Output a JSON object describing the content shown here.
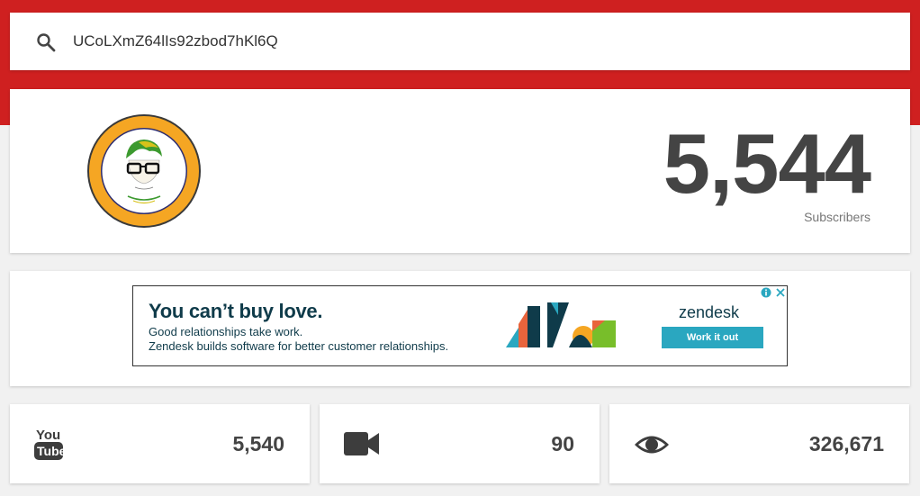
{
  "search": {
    "value": "UCoLXmZ64lIs92zbod7hKl6Q",
    "icon": "search-icon"
  },
  "channel": {
    "avatar_icon": "channel-avatar",
    "subscriber_count": "5,544",
    "subscriber_label": "Subscribers"
  },
  "ad": {
    "headline": "You can’t buy love.",
    "line1": "Good relationships take work.",
    "line2": "Zendesk builds software for better customer relationships.",
    "brand": "zendesk",
    "cta": "Work it out"
  },
  "stats": [
    {
      "icon": "youtube-logo-icon",
      "value": "5,540"
    },
    {
      "icon": "video-camera-icon",
      "value": "90"
    },
    {
      "icon": "eye-icon",
      "value": "326,671"
    }
  ],
  "colors": {
    "header_red": "#cf2020",
    "background": "#f1f1f1",
    "text": "#444444",
    "ad_cta": "#2aa7c0"
  }
}
